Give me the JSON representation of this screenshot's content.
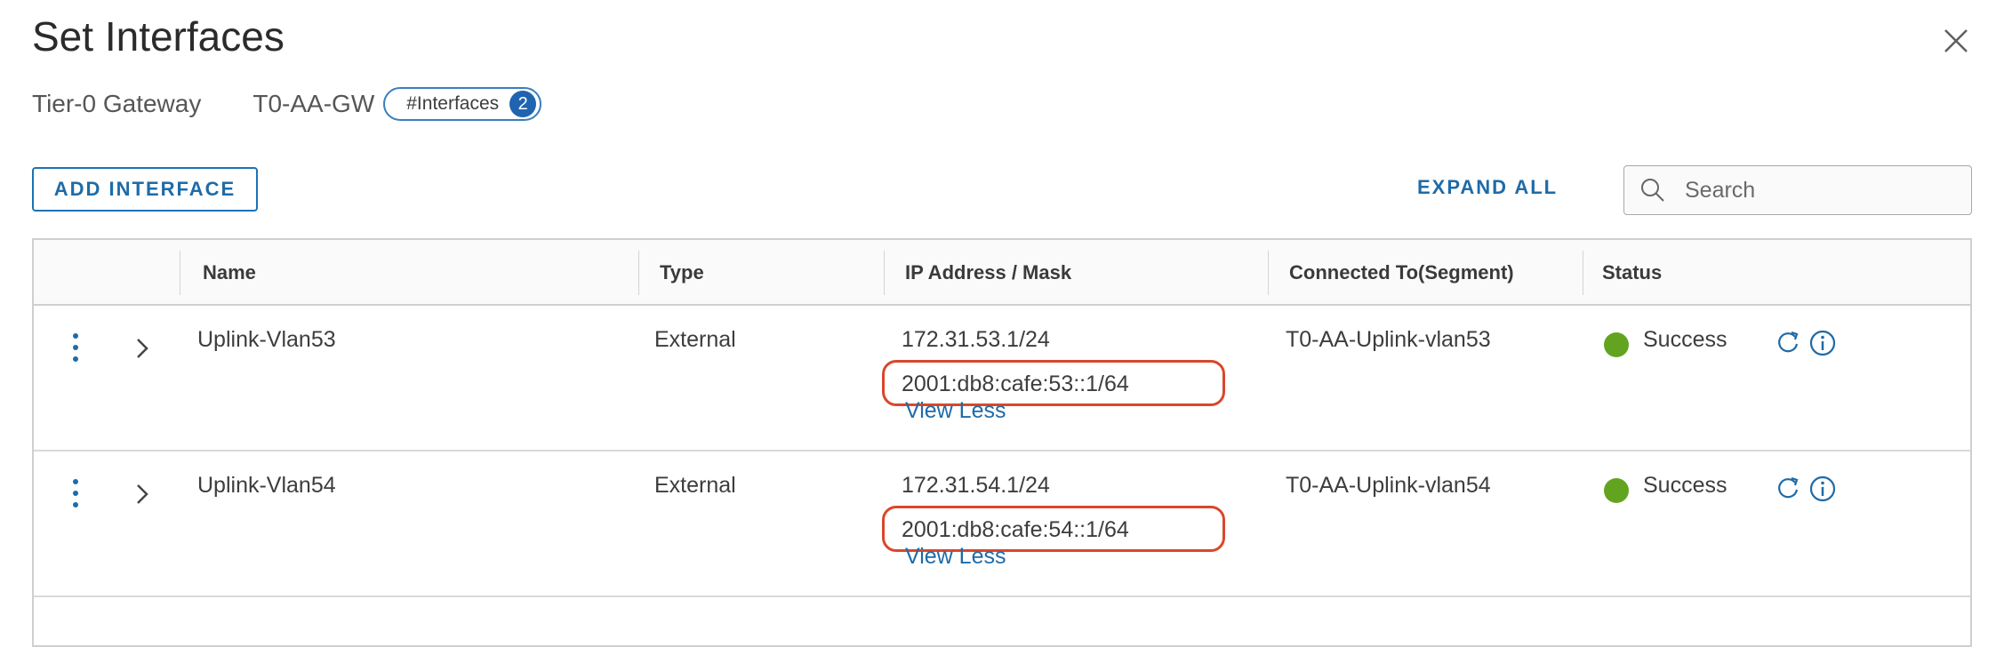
{
  "dialog": {
    "title": "Set Interfaces",
    "gateway_label": "Tier-0 Gateway",
    "gateway_name": "T0-AA-GW",
    "badge_label": "#Interfaces",
    "badge_count": "2"
  },
  "toolbar": {
    "add_interface_label": "ADD INTERFACE",
    "expand_all_label": "EXPAND ALL",
    "search_placeholder": "Search"
  },
  "table": {
    "headers": [
      "Name",
      "Type",
      "IP Address / Mask",
      "Connected To(Segment)",
      "Status"
    ],
    "rows": [
      {
        "name": "Uplink-Vlan53",
        "type": "External",
        "ipv4": "172.31.53.1/24",
        "ipv6": "2001:db8:cafe:53::1/64",
        "view_less": "View Less",
        "segment": "T0-AA-Uplink-vlan53",
        "status": "Success"
      },
      {
        "name": "Uplink-Vlan54",
        "type": "External",
        "ipv4": "172.31.54.1/24",
        "ipv6": "2001:db8:cafe:54::1/64",
        "view_less": "View Less",
        "segment": "T0-AA-Uplink-vlan54",
        "status": "Success"
      }
    ]
  },
  "colors": {
    "accent": "#1e6ba8",
    "success": "#62a420",
    "highlight": "#d9472b"
  },
  "icons": [
    "close-icon",
    "search-icon",
    "kebab-menu-icon",
    "chevron-right-icon",
    "refresh-icon",
    "info-icon"
  ]
}
